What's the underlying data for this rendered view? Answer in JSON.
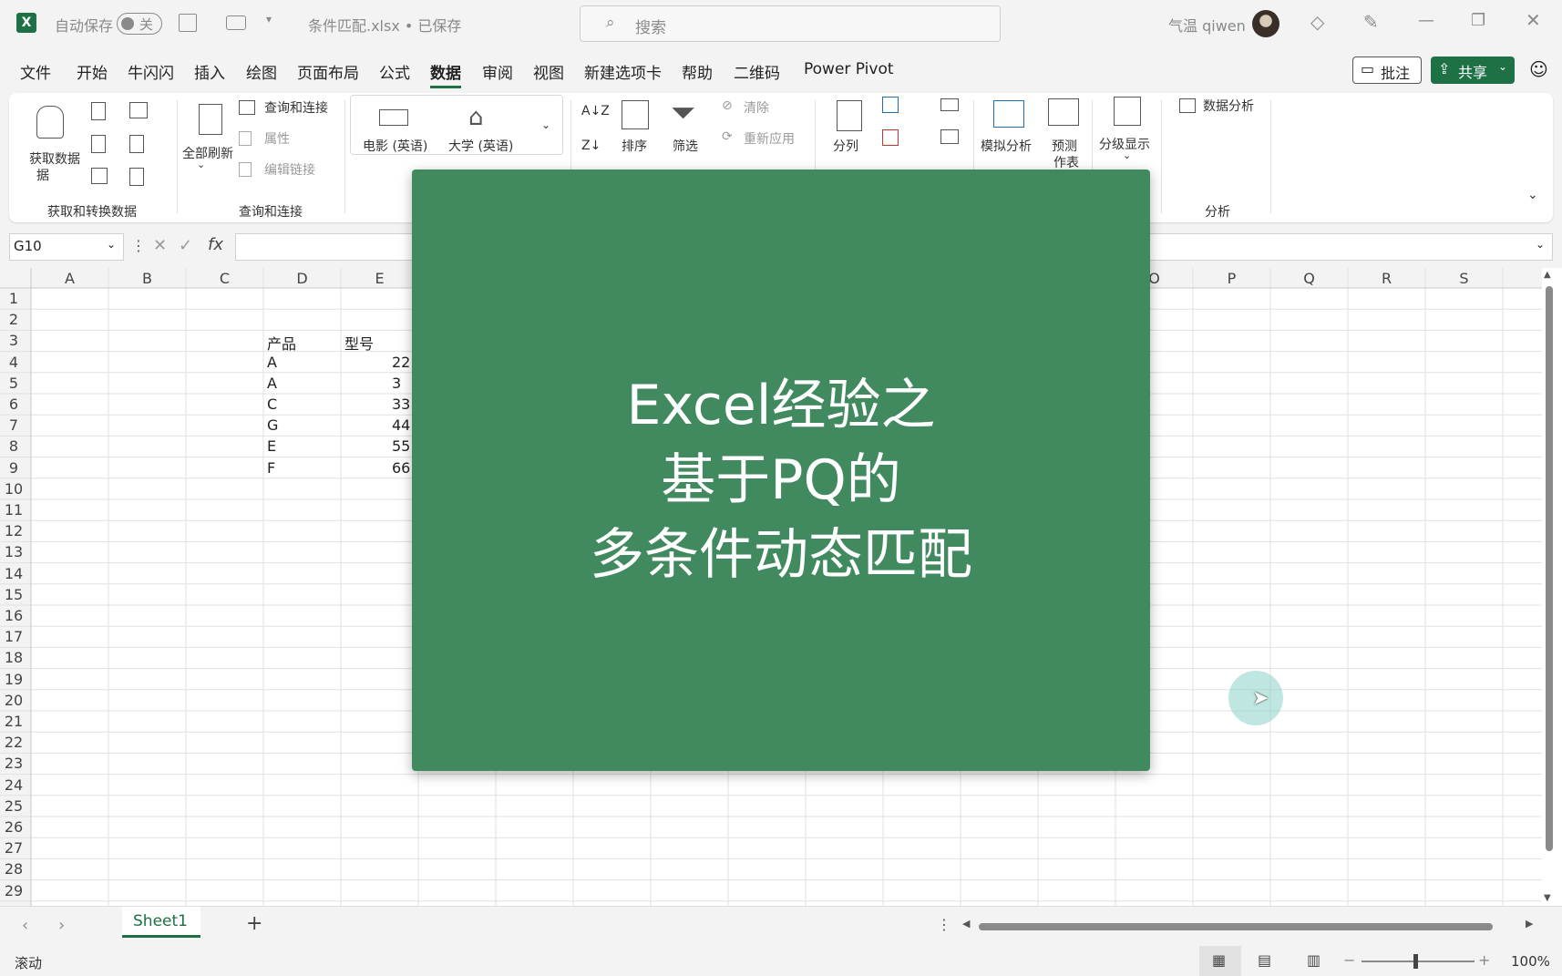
{
  "titlebar": {
    "autosave_label": "自动保存",
    "autosave_state": "关",
    "filename": "条件匹配.xlsx • 已保存",
    "search_placeholder": "搜索",
    "user_name": "气温 qiwen"
  },
  "menu": {
    "tabs": [
      "文件",
      "开始",
      "牛闪闪",
      "插入",
      "绘图",
      "页面布局",
      "公式",
      "数据",
      "审阅",
      "视图",
      "新建选项卡",
      "帮助",
      "二维码",
      "Power Pivot"
    ],
    "active_tab": "数据",
    "comment_button": "批注",
    "share_button": "共享"
  },
  "ribbon": {
    "get_data": "获取数据",
    "get_data_line2": "据",
    "group_get_transform": "获取和转换数据",
    "refresh_all": "全部刷新",
    "queries_connections": "查询和连接",
    "properties": "属性",
    "edit_links": "编辑链接",
    "group_queries": "查询和连接",
    "movies": "电影 (英语)",
    "university": "大学 (英语)",
    "sort": "排序",
    "filter": "筛选",
    "clear": "清除",
    "reapply": "重新应用",
    "split": "分列",
    "whatif": "模拟分析",
    "forecast": "预测",
    "forecast_line2": "作表",
    "outline": "分级显示",
    "data_analysis": "数据分析",
    "group_analysis": "分析"
  },
  "formula_bar": {
    "name_box": "G10",
    "fx": "fx",
    "value": ""
  },
  "grid": {
    "columns_left": [
      "A",
      "B",
      "C",
      "D",
      "E"
    ],
    "columns_right": [
      "O",
      "P",
      "Q",
      "R",
      "S"
    ],
    "rows": [
      "1",
      "2",
      "3",
      "4",
      "5",
      "6",
      "7",
      "8",
      "9",
      "10",
      "11",
      "12",
      "13",
      "14",
      "15",
      "16",
      "17",
      "18",
      "19",
      "20",
      "21",
      "22",
      "23",
      "24",
      "25",
      "26",
      "27",
      "28",
      "29"
    ],
    "header_product": "产品",
    "header_model": "型号",
    "products": [
      "A",
      "A",
      "C",
      "G",
      "E",
      "F"
    ],
    "models_visible": [
      "22",
      "3",
      "33",
      "44",
      "55",
      "66"
    ]
  },
  "overlay": {
    "line1": "Excel经验之",
    "line2": "基于PQ的",
    "line3": "多条件动态匹配",
    "color": "#418a5f"
  },
  "sheets": {
    "tabs": [
      "Sheet1"
    ],
    "add": "+"
  },
  "status": {
    "mode": "滚动",
    "zoom": "100%"
  }
}
